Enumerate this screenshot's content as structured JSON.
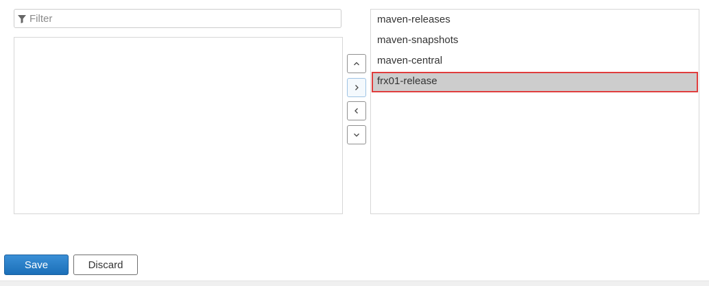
{
  "filter": {
    "placeholder": "Filter",
    "value": "",
    "icon": "filter-icon"
  },
  "available_members": {
    "items": []
  },
  "selected_members": {
    "items": [
      {
        "label": "maven-releases",
        "selected": false
      },
      {
        "label": "maven-snapshots",
        "selected": false
      },
      {
        "label": "maven-central",
        "selected": false
      },
      {
        "label": "frx01-release",
        "selected": true
      }
    ]
  },
  "move_controls": {
    "up_icon": "chevron-up-icon",
    "add_icon": "chevron-right-icon",
    "remove_icon": "chevron-left-icon",
    "down_icon": "chevron-down-icon"
  },
  "actions": {
    "save_label": "Save",
    "discard_label": "Discard"
  },
  "colors": {
    "primary_button": "#1b6fb8",
    "selection_background": "#cdcdcd",
    "highlight_border": "#e03c3c"
  }
}
